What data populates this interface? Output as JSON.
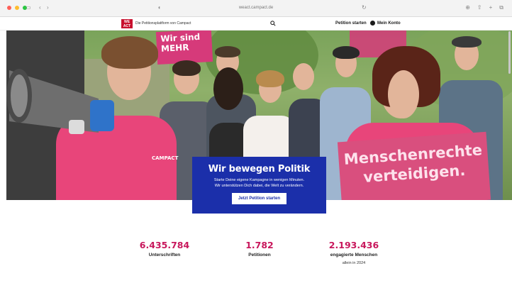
{
  "browser": {
    "url": "weact.campact.de",
    "colors": {
      "close": "#ff5f57",
      "minimize": "#febc2e",
      "zoom": "#28c840"
    }
  },
  "header": {
    "logo_text": "WE ACT",
    "tagline": "Die Petitionsplattform von Campact",
    "nav": {
      "start_petition": "Petition starten",
      "account": "Mein Konto"
    }
  },
  "hero": {
    "signs": {
      "left_sign": "Wir sind MEHR",
      "right_sign": "Menschenrechte verteidigen.",
      "shirt_text": "CAMPACT"
    },
    "title": "Wir bewegen Politik",
    "subtitle_line1": "Starte Deine eigene Kampagne in wenigen Minuten.",
    "subtitle_line2": "Wir unterstützen Dich dabei, die Welt zu verändern.",
    "cta": "Jetzt Petition starten"
  },
  "stats": [
    {
      "value": "6.435.784",
      "label": "Unterschriften",
      "note": ""
    },
    {
      "value": "1.782",
      "label": "Petitionen",
      "note": ""
    },
    {
      "value": "2.193.436",
      "label": "engagierte Menschen",
      "note": "allein in 2024"
    }
  ],
  "colors": {
    "brand_red": "#c8102e",
    "stat_pink": "#c8175c",
    "hero_blue": "#1b2faa"
  }
}
